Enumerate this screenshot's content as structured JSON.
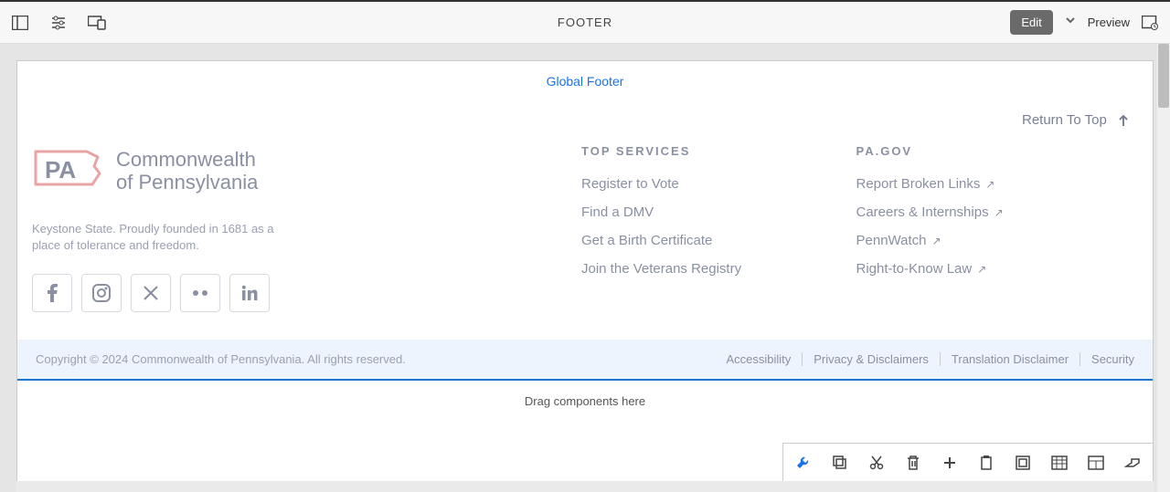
{
  "topbar": {
    "title": "FOOTER",
    "edit": "Edit",
    "preview": "Preview"
  },
  "global_footer_label": "Global Footer",
  "return_top": "Return To Top",
  "brand": {
    "line1": "Commonwealth",
    "line2": "of Pennsylvania",
    "tagline": "Keystone State. Proudly founded in 1681 as a place of tolerance and freedom."
  },
  "columns": {
    "services": {
      "head": "TOP SERVICES",
      "items": [
        "Register to Vote",
        "Find a DMV",
        "Get a Birth Certificate",
        "Join the Veterans Registry"
      ]
    },
    "pagov": {
      "head": "PA.GOV",
      "items": [
        "Report Broken Links",
        "Careers & Internships",
        "PennWatch",
        "Right-to-Know Law"
      ]
    }
  },
  "bottom": {
    "copyright": "Copyright © 2024 Commonwealth of Pennsylvania. All rights reserved.",
    "links": [
      "Accessibility",
      "Privacy & Disclaimers",
      "Translation Disclaimer",
      "Security"
    ]
  },
  "drag_zone": "Drag components here"
}
